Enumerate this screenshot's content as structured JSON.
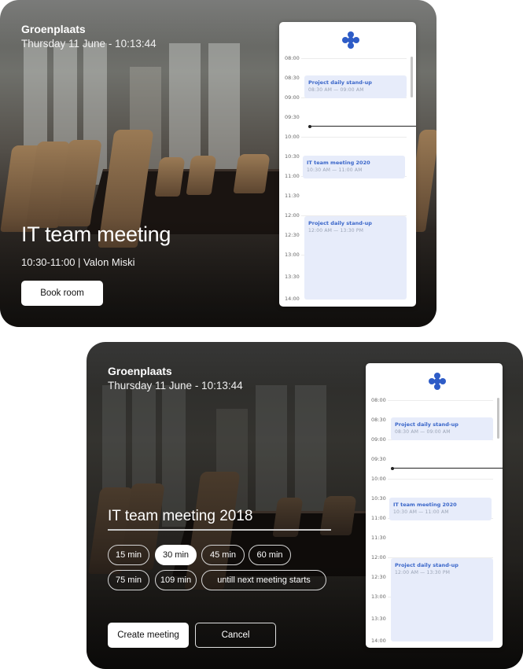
{
  "colors": {
    "accent": "#3a66c9",
    "event_bg": "#e7ecfa",
    "event_time": "#9aa3b5"
  },
  "screen1": {
    "location": "Groenplaats",
    "datetime": "Thursday 11 June - 10:13:44",
    "meeting_title": "IT team meeting",
    "meeting_sub": "10:30-11:00  | Valon Miski",
    "book_button": "Book room"
  },
  "screen2": {
    "location": "Groenplaats",
    "datetime": "Thursday 11 June - 10:13:44",
    "title_value": "IT team meeting 2018",
    "durations": [
      {
        "label": "15 min",
        "selected": false
      },
      {
        "label": "30 min",
        "selected": true
      },
      {
        "label": "45 min",
        "selected": false
      },
      {
        "label": "60 min",
        "selected": false
      },
      {
        "label": "75 min",
        "selected": false
      },
      {
        "label": "109 min",
        "selected": false
      },
      {
        "label": "untill next meeting starts",
        "selected": false
      }
    ],
    "create_button": "Create meeting",
    "cancel_button": "Cancel"
  },
  "calendar": {
    "logo_icon": "company-logo-icon",
    "hours": [
      "08:00",
      "08:30",
      "09:00",
      "09:30",
      "10:00",
      "10:30",
      "11:00",
      "11:30",
      "12:00",
      "12:30",
      "13:00",
      "13:30",
      "14:00"
    ],
    "events": [
      {
        "title": "Project daily stand-up",
        "time": "08:30 AM — 09:00 AM"
      },
      {
        "title": "IT team meeting 2020",
        "time": "10:30 AM — 11:00 AM"
      },
      {
        "title": "Project daily stand-up",
        "time": "12:00 AM — 13:30 PM"
      }
    ]
  }
}
